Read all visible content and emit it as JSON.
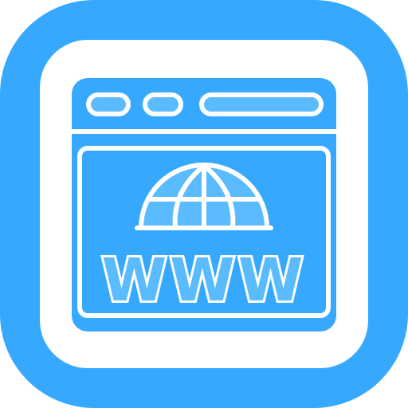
{
  "icon": {
    "name": "website-browser-icon",
    "text": "WWW",
    "colors": {
      "primary": "#36A9FF",
      "light": "#5BBBFF",
      "outline": "#FFFFFF",
      "background": "#FFFFFF"
    }
  }
}
